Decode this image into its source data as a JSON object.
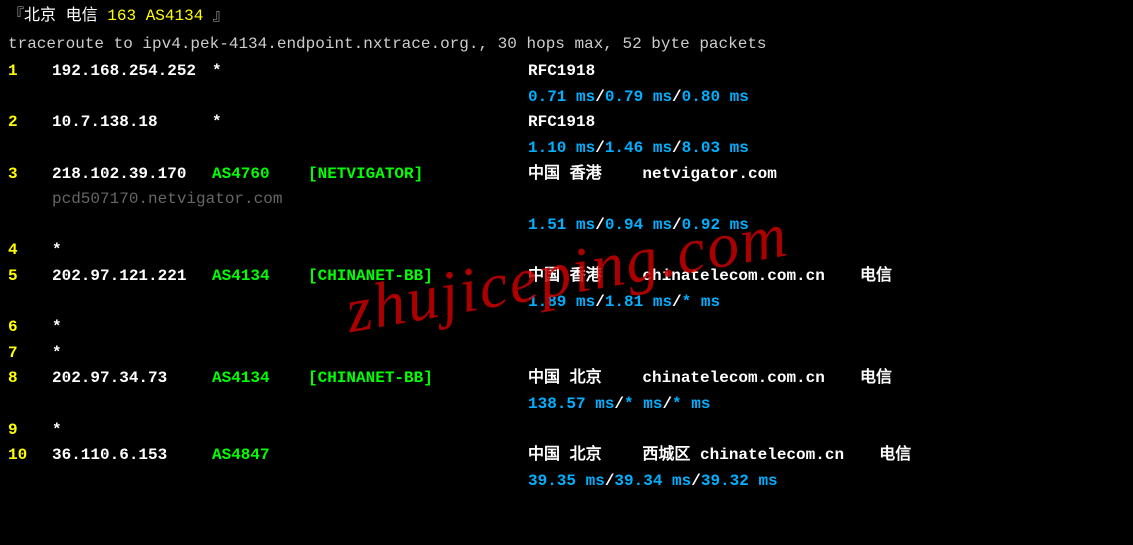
{
  "header": {
    "prefix": "『",
    "city": "北京",
    "isp": "电信",
    "line163": "163",
    "asn": "AS4134",
    "suffix": "』"
  },
  "trace_cmd": "traceroute to ipv4.pek-4134.endpoint.nxtrace.org., 30 hops max, 52 byte packets",
  "hops": [
    {
      "num": "1",
      "ip": "192.168.254.252",
      "star": "*",
      "asn": "",
      "net": "",
      "loc": "RFC1918",
      "org": "",
      "isp": "",
      "lat": [
        "0.71 ms",
        "0.79 ms",
        "0.80 ms"
      ],
      "rdns": ""
    },
    {
      "num": "2",
      "ip": "10.7.138.18",
      "star": "*",
      "asn": "",
      "net": "",
      "loc": "RFC1918",
      "org": "",
      "isp": "",
      "lat": [
        "1.10 ms",
        "1.46 ms",
        "8.03 ms"
      ],
      "rdns": ""
    },
    {
      "num": "3",
      "ip": "218.102.39.170",
      "star": "",
      "asn": "AS4760",
      "net": "[NETVIGATOR]",
      "loc": "中国 香港",
      "org": "netvigator.com",
      "isp": "",
      "lat": [
        "1.51 ms",
        "0.94 ms",
        "0.92 ms"
      ],
      "rdns": "pcd507170.netvigator.com"
    },
    {
      "num": "4",
      "type": "star",
      "star": "*"
    },
    {
      "num": "5",
      "ip": "202.97.121.221",
      "star": "",
      "asn": "AS4134",
      "net": "[CHINANET-BB]",
      "loc": "中国 香港",
      "org": "chinatelecom.com.cn",
      "isp": "电信",
      "lat": [
        "1.89 ms",
        "1.81 ms",
        "* ms"
      ],
      "rdns": ""
    },
    {
      "num": "6",
      "type": "star",
      "star": "*"
    },
    {
      "num": "7",
      "type": "star",
      "star": "*"
    },
    {
      "num": "8",
      "ip": "202.97.34.73",
      "star": "",
      "asn": "AS4134",
      "net": "[CHINANET-BB]",
      "loc": "中国 北京",
      "org": "chinatelecom.com.cn",
      "isp": "电信",
      "lat": [
        "138.57 ms",
        "* ms",
        "* ms"
      ],
      "rdns": ""
    },
    {
      "num": "9",
      "type": "star",
      "star": "*"
    },
    {
      "num": "10",
      "ip": "36.110.6.153",
      "star": "",
      "asn": "AS4847",
      "net": "",
      "loc": "中国 北京",
      "org": "西城区 chinatelecom.cn",
      "isp": "电信",
      "lat": [
        "39.35 ms",
        "39.34 ms",
        "39.32 ms"
      ],
      "rdns": ""
    }
  ],
  "watermark": "zhujiceping.com"
}
